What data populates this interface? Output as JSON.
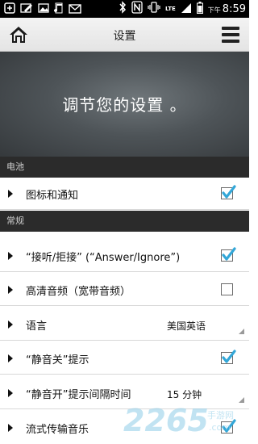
{
  "status_bar": {
    "network": "LTE",
    "ampm": "下午",
    "time": "8:59"
  },
  "action_bar": {
    "title": "设置"
  },
  "banner": {
    "text": "调节您的设置 。"
  },
  "sections": [
    {
      "header": "电池",
      "items": [
        {
          "label": "图标和通知",
          "control": "checkbox",
          "checked": true
        }
      ]
    },
    {
      "header": "常规",
      "items": [
        {
          "label": "“接听/拒接” (“Answer/Ignore”)",
          "control": "checkbox",
          "checked": true
        },
        {
          "label": "高清音频（宽带音频）",
          "control": "checkbox",
          "checked": false
        },
        {
          "label": "语言",
          "control": "select",
          "value": "美国英语"
        },
        {
          "label": "“静音关”提示",
          "control": "checkbox",
          "checked": true
        },
        {
          "label": "“静音开”提示间隔时间",
          "control": "select",
          "value": "15 分钟"
        },
        {
          "label": "流式传输音乐",
          "control": "checkbox",
          "checked": true
        }
      ]
    }
  ],
  "colors": {
    "check_accent": "#33a7d8",
    "section_header_bg": "#2b2b2b"
  },
  "watermark": {
    "digits": "2265",
    "suffix": ".com",
    "text": "手游网"
  }
}
